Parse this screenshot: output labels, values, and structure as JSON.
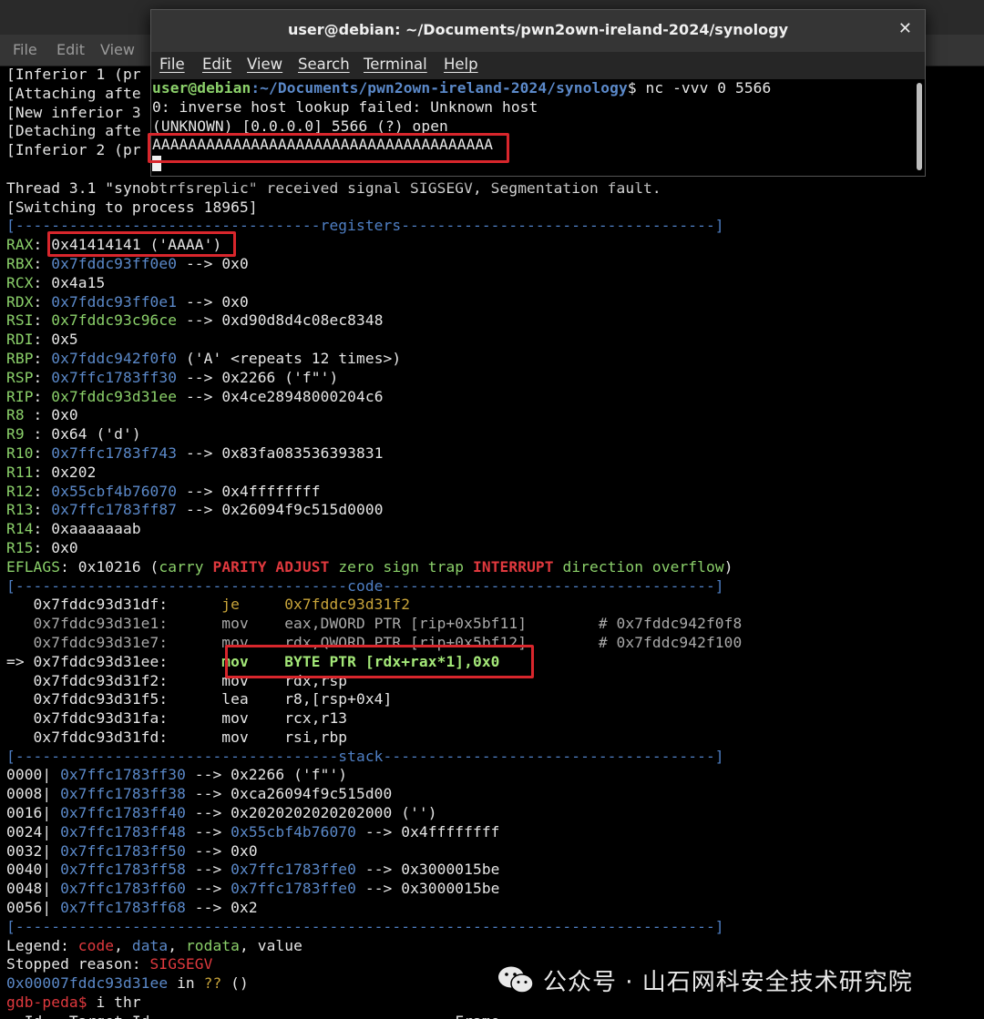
{
  "background_window": {
    "menu": [
      "File",
      "Edit",
      "View"
    ],
    "lines": [
      [
        [
          "[Inferior 1 (pr",
          "white"
        ]
      ],
      [
        [
          "[Attaching afte",
          "white"
        ]
      ],
      [
        [
          "[New inferior 3",
          "white"
        ]
      ],
      [
        [
          "[Detaching afte",
          "white"
        ]
      ],
      [
        [
          "[Inferior 2 (pr",
          "white"
        ]
      ],
      [
        [
          "",
          "white"
        ]
      ],
      [
        [
          "Thread 3.1 \"synobtrfsreplic\" received signal SIGSEGV, Segmentation fault.",
          "white"
        ]
      ],
      [
        [
          "[Switching to process 18965]",
          "white"
        ]
      ],
      [
        [
          "[----------------------------------registers-----------------------------------]",
          "rule"
        ]
      ],
      [
        [
          "RAX",
          "green"
        ],
        [
          ": ",
          "white"
        ],
        [
          "0x41414141 ('AAAA')",
          "white"
        ]
      ],
      [
        [
          "RBX",
          "green"
        ],
        [
          ": ",
          "white"
        ],
        [
          "0x7fddc93ff0e0",
          "blue"
        ],
        [
          " --> 0x0",
          "white"
        ]
      ],
      [
        [
          "RCX",
          "green"
        ],
        [
          ": 0x4a15",
          "white"
        ]
      ],
      [
        [
          "RDX",
          "green"
        ],
        [
          ": ",
          "white"
        ],
        [
          "0x7fddc93ff0e1",
          "blue"
        ],
        [
          " --> 0x0",
          "white"
        ]
      ],
      [
        [
          "RSI",
          "green"
        ],
        [
          ": ",
          "white"
        ],
        [
          "0x7fddc93c96ce",
          "green"
        ],
        [
          " --> 0xd90d8d4c08ec8348",
          "white"
        ]
      ],
      [
        [
          "RDI",
          "green"
        ],
        [
          ": 0x5",
          "white"
        ]
      ],
      [
        [
          "RBP",
          "green"
        ],
        [
          ": ",
          "white"
        ],
        [
          "0x7fddc942f0f0",
          "blue"
        ],
        [
          " ('A' <repeats 12 times>)",
          "white"
        ]
      ],
      [
        [
          "RSP",
          "green"
        ],
        [
          ": ",
          "white"
        ],
        [
          "0x7ffc1783ff30",
          "blue"
        ],
        [
          " --> 0x2266 ('f\"')",
          "white"
        ]
      ],
      [
        [
          "RIP",
          "green"
        ],
        [
          ": ",
          "white"
        ],
        [
          "0x7fddc93d31ee",
          "green"
        ],
        [
          " --> 0x4ce28948000204c6",
          "white"
        ]
      ],
      [
        [
          "R8 ",
          "green"
        ],
        [
          ": 0x0",
          "white"
        ]
      ],
      [
        [
          "R9 ",
          "green"
        ],
        [
          ": 0x64 ('d')",
          "white"
        ]
      ],
      [
        [
          "R10",
          "green"
        ],
        [
          ": ",
          "white"
        ],
        [
          "0x7ffc1783f743",
          "blue"
        ],
        [
          " --> 0x83fa083536393831",
          "white"
        ]
      ],
      [
        [
          "R11",
          "green"
        ],
        [
          ": 0x202",
          "white"
        ]
      ],
      [
        [
          "R12",
          "green"
        ],
        [
          ": ",
          "white"
        ],
        [
          "0x55cbf4b76070",
          "blue"
        ],
        [
          " --> 0x4ffffffff",
          "white"
        ]
      ],
      [
        [
          "R13",
          "green"
        ],
        [
          ": ",
          "white"
        ],
        [
          "0x7ffc1783ff87",
          "blue"
        ],
        [
          " --> 0x26094f9c515d0000",
          "white"
        ]
      ],
      [
        [
          "R14",
          "green"
        ],
        [
          ": 0xaaaaaaab",
          "white"
        ]
      ],
      [
        [
          "R15",
          "green"
        ],
        [
          ": 0x0",
          "white"
        ]
      ],
      [
        [
          "EFLAGS",
          "green"
        ],
        [
          ": 0x10216 (",
          "white"
        ],
        [
          "carry ",
          "green"
        ],
        [
          "PARITY ADJUST ",
          "red-b"
        ],
        [
          "zero sign trap ",
          "green"
        ],
        [
          "INTERRUPT ",
          "red-b"
        ],
        [
          "direction overflow",
          "green"
        ],
        [
          ")",
          "white"
        ]
      ],
      [
        [
          "[-------------------------------------code-------------------------------------]",
          "rule"
        ]
      ],
      [
        [
          "   0x7fddc93d31df:      ",
          "white"
        ],
        [
          "je     0x7fddc93d31f2",
          "yellow"
        ]
      ],
      [
        [
          "   0x7fddc93d31e1:      mov    eax,DWORD PTR [rip+0x5bf11]        # 0x7fddc942f0f8",
          "gray"
        ]
      ],
      [
        [
          "   0x7fddc93d31e7:      mov    rdx,QWORD PTR [rip+0x5bf12]        # 0x7fddc942f100",
          "gray"
        ]
      ],
      [
        [
          "=> 0x7fddc93d31ee:      ",
          "white"
        ],
        [
          "mov    BYTE PTR [rdx+rax*1],0x0",
          "green-b"
        ]
      ],
      [
        [
          "   0x7fddc93d31f2:      mov    rdx,rsp",
          "white"
        ]
      ],
      [
        [
          "   0x7fddc93d31f5:      lea    r8,[rsp+0x4]",
          "white"
        ]
      ],
      [
        [
          "   0x7fddc93d31fa:      mov    rcx,r13",
          "white"
        ]
      ],
      [
        [
          "   0x7fddc93d31fd:      mov    rsi,rbp",
          "white"
        ]
      ],
      [
        [
          "[------------------------------------stack-------------------------------------]",
          "rule"
        ]
      ],
      [
        [
          "0000| ",
          "white"
        ],
        [
          "0x7ffc1783ff30",
          "blue"
        ],
        [
          " --> 0x2266 ('f\"')",
          "white"
        ]
      ],
      [
        [
          "0008| ",
          "white"
        ],
        [
          "0x7ffc1783ff38",
          "blue"
        ],
        [
          " --> 0xca26094f9c515d00",
          "white"
        ]
      ],
      [
        [
          "0016| ",
          "white"
        ],
        [
          "0x7ffc1783ff40",
          "blue"
        ],
        [
          " --> 0x2020202020202000 ('')",
          "white"
        ]
      ],
      [
        [
          "0024| ",
          "white"
        ],
        [
          "0x7ffc1783ff48",
          "blue"
        ],
        [
          " --> ",
          "white"
        ],
        [
          "0x55cbf4b76070",
          "blue"
        ],
        [
          " --> 0x4ffffffff",
          "white"
        ]
      ],
      [
        [
          "0032| ",
          "white"
        ],
        [
          "0x7ffc1783ff50",
          "blue"
        ],
        [
          " --> 0x0",
          "white"
        ]
      ],
      [
        [
          "0040| ",
          "white"
        ],
        [
          "0x7ffc1783ff58",
          "blue"
        ],
        [
          " --> ",
          "white"
        ],
        [
          "0x7ffc1783ffe0",
          "blue"
        ],
        [
          " --> 0x3000015be",
          "white"
        ]
      ],
      [
        [
          "0048| ",
          "white"
        ],
        [
          "0x7ffc1783ff60",
          "blue"
        ],
        [
          " --> ",
          "white"
        ],
        [
          "0x7ffc1783ffe0",
          "blue"
        ],
        [
          " --> 0x3000015be",
          "white"
        ]
      ],
      [
        [
          "0056| ",
          "white"
        ],
        [
          "0x7ffc1783ff68",
          "blue"
        ],
        [
          " --> 0x2",
          "white"
        ]
      ],
      [
        [
          "[------------------------------------------------------------------------------]",
          "rule"
        ]
      ],
      [
        [
          "Legend: ",
          "white"
        ],
        [
          "code",
          "red"
        ],
        [
          ", ",
          "white"
        ],
        [
          "data",
          "blue"
        ],
        [
          ", ",
          "white"
        ],
        [
          "rodata",
          "green"
        ],
        [
          ", value",
          "white"
        ]
      ],
      [
        [
          "Stopped reason: ",
          "white"
        ],
        [
          "SIGSEGV",
          "red"
        ]
      ],
      [
        [
          "0x00007fddc93d31ee",
          "blue"
        ],
        [
          " in ",
          "white"
        ],
        [
          "??",
          "yellow"
        ],
        [
          " ()",
          "white"
        ]
      ],
      [
        [
          "gdb-peda$",
          "red"
        ],
        [
          " i thr",
          "white"
        ]
      ],
      [
        [
          "  Id   Target Id                                  Frame",
          "white"
        ]
      ]
    ]
  },
  "foreground_window": {
    "title": "user@debian: ~/Documents/pwn2own-ireland-2024/synology",
    "menu": [
      "File",
      "Edit",
      "View",
      "Search",
      "Terminal",
      "Help"
    ],
    "prompt_user": "user@debian",
    "prompt_path": ":~/Documents/pwn2own-ireland-2024/synology",
    "command": "$ nc -vvv 0 5566",
    "output": [
      "0: inverse host lookup failed: Unknown host",
      "(UNKNOWN) [0.0.0.0] 5566 (?) open",
      "AAAAAAAAAAAAAAAAAAAAAAAAAAAAAAAAAAAAAA"
    ]
  },
  "watermark": {
    "text": "公众号 · 山石网科安全技术研究院",
    "icon": "wechat-icon"
  },
  "colors": {
    "highlight": "#d8262c",
    "green": "#8bd06a",
    "blue": "#5b89c9",
    "red": "#e0393e",
    "yellow": "#c8a43a"
  }
}
